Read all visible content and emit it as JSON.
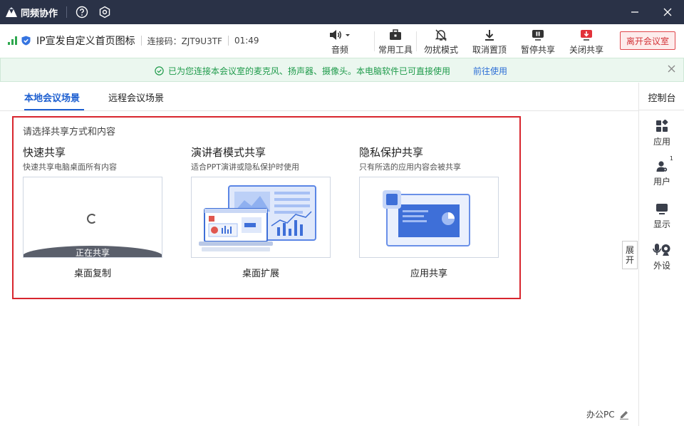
{
  "app": {
    "title": "同频协作"
  },
  "meeting": {
    "title": "IP宣发自定义首页图标",
    "code_label": "连接码：ZJT9U3TF",
    "duration": "01:49"
  },
  "toolbar": {
    "audio": "音频",
    "common_tools": "常用工具",
    "dnd": "勿扰模式",
    "unpin": "取消置顶",
    "pause_share": "暂停共享",
    "close_share": "关闭共享",
    "leave": "离开会议室"
  },
  "notice": {
    "message": "已为您连接本会议室的麦克风、扬声器、摄像头。本电脑软件已可直接使用",
    "link": "前往使用"
  },
  "tabs": {
    "local": "本地会议场景",
    "remote": "远程会议场景"
  },
  "share": {
    "hint": "请选择共享方式和内容",
    "cards": [
      {
        "title": "快速共享",
        "subtitle": "快速共享电脑桌面所有内容",
        "label": "桌面复制",
        "status": "正在共享"
      },
      {
        "title": "演讲者模式共享",
        "subtitle": "适合PPT演讲或隐私保护时使用",
        "label": "桌面扩展"
      },
      {
        "title": "隐私保护共享",
        "subtitle": "只有所选的应用内容会被共享",
        "label": "应用共享"
      }
    ]
  },
  "console": {
    "title": "控制台",
    "items": [
      "应用",
      "用户",
      "显示",
      "外设"
    ],
    "user_badge": "1"
  },
  "expand": {
    "label_top": "展",
    "label_bottom": "开"
  },
  "footer": {
    "device": "办公PC"
  },
  "colors": {
    "titlebar": "#2a3247",
    "accent": "#1d5fd0",
    "leave": "#d3353a",
    "notice_text": "#1f9b4b",
    "highlight_border": "#d8262e"
  }
}
